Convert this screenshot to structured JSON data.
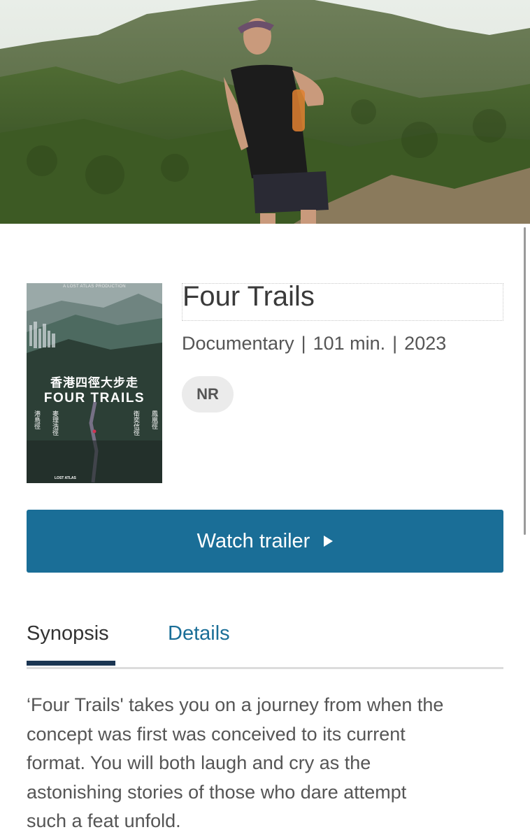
{
  "hero": {
    "image": "woman-trail-runner-mountain-photo"
  },
  "poster": {
    "image": "four-trails-movie-poster",
    "production_line": "A LOST ATLAS PRODUCTION",
    "chinese_title": "香港四徑大步走",
    "english_title": "FOUR TRAILS",
    "trail_names": [
      "港島徑",
      "麥理浩徑",
      "衛奕信徑",
      "鳳凰徑"
    ],
    "studio": "LOST ATLAS"
  },
  "movie": {
    "title": "Four Trails",
    "genre": "Documentary",
    "runtime": "101 min.",
    "year": "2023",
    "separator": "|",
    "rating": "NR"
  },
  "actions": {
    "watch_trailer_label": "Watch trailer",
    "play_icon": "play-triangle-icon"
  },
  "tabs": [
    {
      "label": "Synopsis",
      "active": true
    },
    {
      "label": "Details",
      "active": false
    }
  ],
  "synopsis": {
    "lines": [
      "‘Four Trails' takes you on a journey from when the",
      "concept was first was conceived to its current",
      "format. You will both laugh and cry as the",
      "astonishing stories of those who dare attempt",
      "such a feat unfold."
    ]
  },
  "colors": {
    "accent": "#1a6e97",
    "tab_underline": "#1a3552",
    "badge_bg": "#ebebeb"
  }
}
